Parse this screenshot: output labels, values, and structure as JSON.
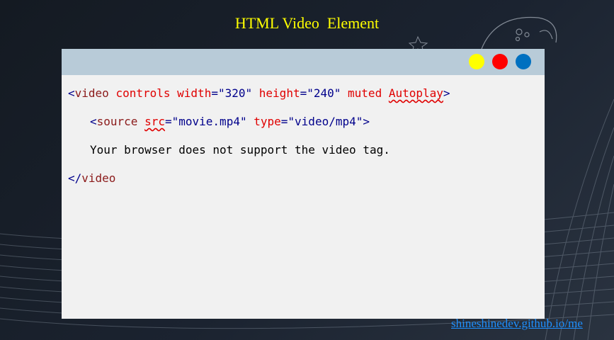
{
  "slide": {
    "title": "HTML Video  Element"
  },
  "window": {
    "dots": [
      {
        "name": "yellow",
        "color": "#ffff00"
      },
      {
        "name": "red",
        "color": "#ff0000"
      },
      {
        "name": "blue",
        "color": "#0070c0"
      }
    ]
  },
  "code": {
    "line1": {
      "open": "<",
      "tag": "video",
      "attr1": "controls",
      "attr2": "width",
      "eq": "=",
      "val2": "\"320\"",
      "attr3": "height",
      "val3": "\"240\"",
      "attr4": "muted",
      "attr5": "Autoplay",
      "close": ">"
    },
    "line2": {
      "open": "<",
      "tag": "source",
      "attr1": "src",
      "eq": "=",
      "val1": "\"movie.mp4\"",
      "attr2": "type",
      "val2": "\"video/mp4\"",
      "close": ">"
    },
    "line3": {
      "text": "Your browser does not support the video tag."
    },
    "line4": {
      "open": "</",
      "tag": "video"
    }
  },
  "credit": {
    "text": "shineshinedev.github.io/me"
  }
}
